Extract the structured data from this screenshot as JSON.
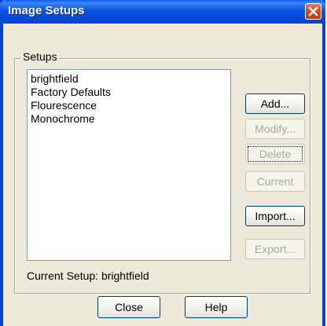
{
  "window": {
    "title": "Image Setups"
  },
  "setups": {
    "group_label": "Setups",
    "items": [
      "brightfield",
      "Factory Defaults",
      "Flourescence",
      "Monochrome"
    ]
  },
  "buttons": {
    "add": "Add...",
    "modify": "Modify...",
    "delete": "Delete",
    "current": "Current",
    "import": "Import...",
    "export": "Export..."
  },
  "status": {
    "current_setup": "Current Setup: brightfield"
  },
  "footer": {
    "close": "Close",
    "help": "Help"
  }
}
